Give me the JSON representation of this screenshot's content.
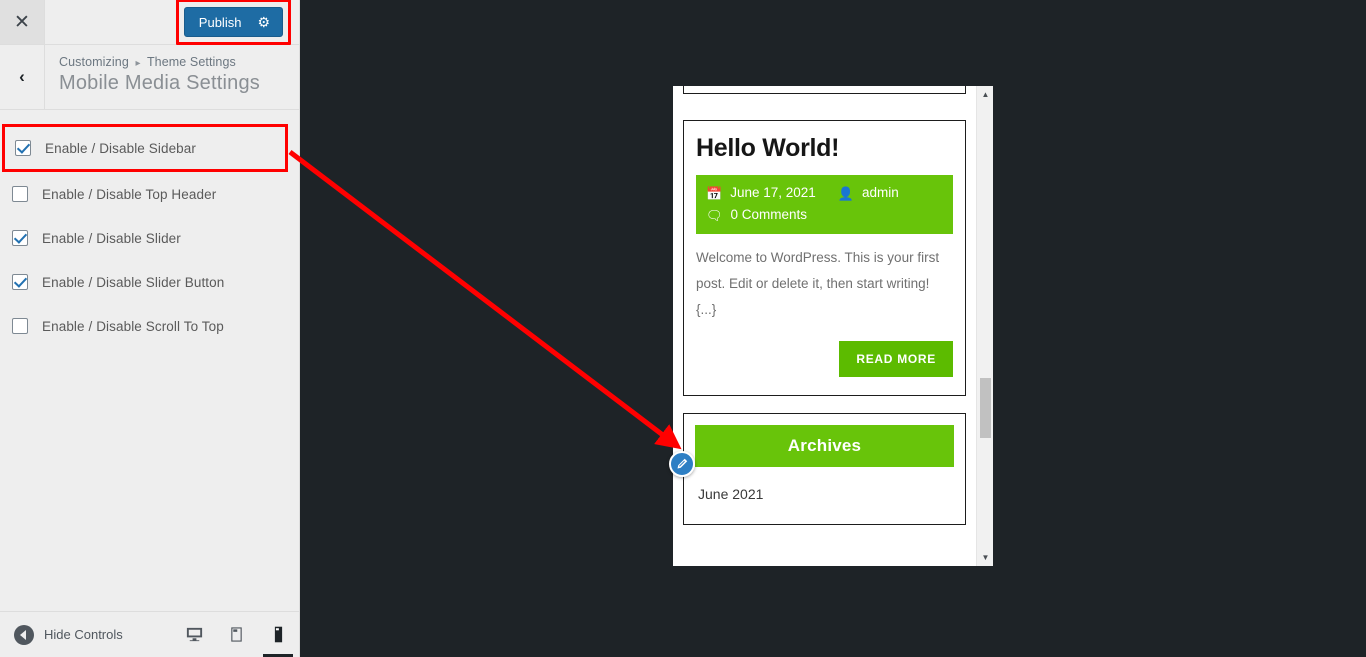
{
  "customizer": {
    "close_label": "✕",
    "back_label": "‹",
    "publish_label": "Publish",
    "publish_gear_icon": "gear-icon",
    "breadcrumb_root": "Customizing",
    "breadcrumb_separator": "▸",
    "breadcrumb_current": "Theme Settings",
    "panel_title": "Mobile Media Settings",
    "controls": [
      {
        "label": "Enable / Disable Sidebar",
        "checked": true,
        "highlighted": true
      },
      {
        "label": "Enable / Disable Top Header",
        "checked": false,
        "highlighted": false
      },
      {
        "label": "Enable / Disable Slider",
        "checked": true,
        "highlighted": false
      },
      {
        "label": "Enable / Disable Slider Button",
        "checked": true,
        "highlighted": false
      },
      {
        "label": "Enable / Disable Scroll To Top",
        "checked": false,
        "highlighted": false
      }
    ],
    "footer": {
      "hide_controls_label": "Hide Controls",
      "devices": [
        {
          "name": "desktop",
          "active": false
        },
        {
          "name": "tablet",
          "active": false
        },
        {
          "name": "mobile",
          "active": true
        }
      ]
    }
  },
  "preview": {
    "post": {
      "title": "Hello World!",
      "date": "June 17, 2021",
      "author": "admin",
      "comments": "0 Comments",
      "excerpt": "Welcome to WordPress. This is your first post. Edit or delete it, then start writing!{...}",
      "read_more_label": "READ MORE"
    },
    "widget": {
      "title": "Archives",
      "items": [
        "June 2021"
      ]
    },
    "edit_shortcut_icon": "pencil-icon",
    "scrollbar": {
      "up_arrow": "▲",
      "down_arrow": "▼"
    }
  },
  "colors": {
    "publish_blue": "#1e6ca4",
    "highlight_red": "#ff0000",
    "theme_green": "#68c40a",
    "read_more_green": "#5cbb00",
    "dark_backdrop": "#1e2327",
    "sidebar_bg": "#eeeeee",
    "edit_shortcut_blue": "#2d7fc4"
  }
}
